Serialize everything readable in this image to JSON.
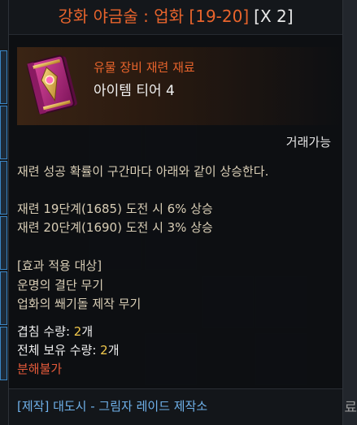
{
  "tooltip": {
    "title_name": "강화 야금술 : 업화 [19-20]",
    "title_count": "[X 2]",
    "item_category": "유물 장비 재련 재료",
    "item_tier": "아이템 티어 4",
    "tradable": "거래가능",
    "description": "재련 성공 확률이 구간마다 아래와 같이 상승한다.",
    "bonuses": [
      "재련 19단계(1685) 도전 시 6% 상승",
      "재련 20단계(1690) 도전 시 3% 상승"
    ],
    "target_header": "[효과 적용 대상]",
    "targets": [
      "운명의 결단 무기",
      "업화의 쐐기돌 제작 무기"
    ],
    "stack_label": "겹침 수량: ",
    "stack_value": "2",
    "stack_unit": "개",
    "owned_label": "전체 보유 수량: ",
    "owned_value": "2",
    "owned_unit": "개",
    "disassemble": "분해불가",
    "source": "[제작] 대도시 - 그림자 레이드 제작소"
  },
  "background": {
    "right_label": "공통 재료"
  },
  "colors": {
    "title_orange": "#e8642c",
    "description_beige": "#d8cdb5",
    "count_gold": "#f2c94c",
    "warning_red": "#e55a3a",
    "source_blue": "#6fb1ea"
  },
  "icons": {
    "item": "magic-tome-icon"
  }
}
